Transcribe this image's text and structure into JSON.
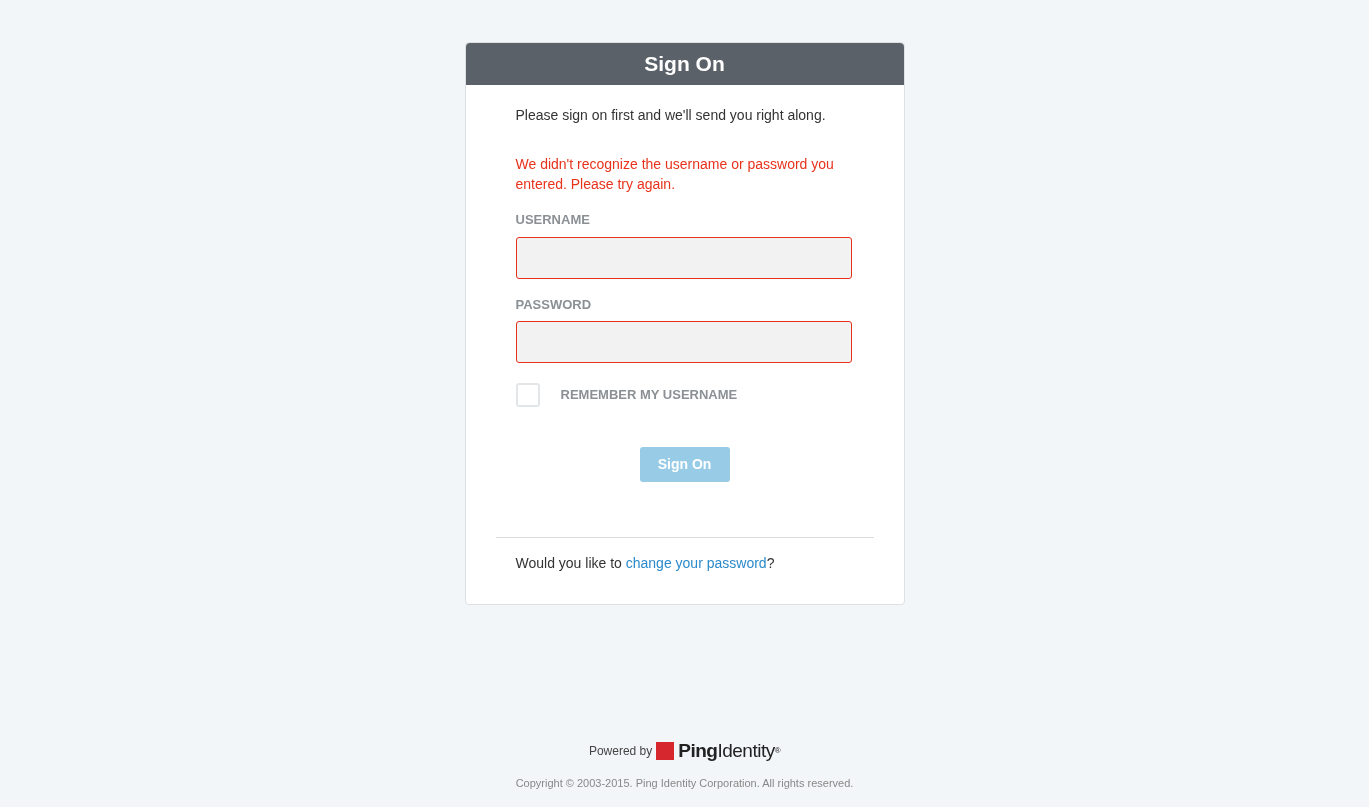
{
  "card": {
    "title": "Sign On",
    "intro": "Please sign on first and we'll send you right along.",
    "error_message": "We didn't recognize the username or password you entered. Please try again.",
    "fields": [
      {
        "label": "USERNAME",
        "error": true
      },
      {
        "label": "PASSWORD",
        "error": true
      }
    ],
    "remember": {
      "label": "REMEMBER MY USERNAME",
      "checked": false
    },
    "submit": {
      "label": "Sign On",
      "disabled": true
    },
    "footer": {
      "before": "Would you like to ",
      "link": "change your password",
      "after": "?"
    }
  },
  "branding": {
    "powered_by": "Powered by",
    "logo": "**Ping**Identity$^{®}$",
    "copyright": "Copyright © 2003-2015. Ping Identity Corporation. All rights reserved."
  }
}
